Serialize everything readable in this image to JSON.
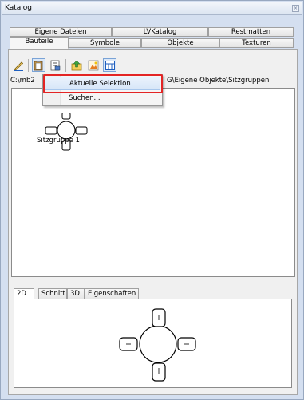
{
  "window": {
    "title": "Katalog",
    "close_glyph": "×"
  },
  "tabs_row1": [
    {
      "label": "Eigene Dateien"
    },
    {
      "label": "LVKatalog"
    },
    {
      "label": "Restmatten"
    }
  ],
  "tabs_row2": [
    {
      "label": "Bauteile",
      "active": true
    },
    {
      "label": "Symbole"
    },
    {
      "label": "Objekte"
    },
    {
      "label": "Texturen"
    }
  ],
  "toolbar": {
    "buttons": [
      {
        "icon": "pencil-icon"
      },
      {
        "icon": "clipboard-icon",
        "pressed": true
      },
      {
        "icon": "properties-icon"
      },
      {
        "icon": "folder-up-icon"
      },
      {
        "icon": "image-icon"
      },
      {
        "icon": "grid-view-icon",
        "pressed": true
      }
    ]
  },
  "path": {
    "left": "C:\\mb2",
    "right": "G\\Eigene Objekte\\Sitzgruppen"
  },
  "context_menu": {
    "items": [
      {
        "label": "Aktuelle Selektion",
        "highlighted": true
      },
      {
        "label": "Suchen..."
      }
    ]
  },
  "list": {
    "items": [
      {
        "label": "Sitzgruppe 1"
      }
    ]
  },
  "bottom_tabs": [
    {
      "label": "2D",
      "active": true
    },
    {
      "label": "Schnitt"
    },
    {
      "label": "3D"
    },
    {
      "label": "Eigenschaften"
    }
  ],
  "colors": {
    "highlight_outline": "#e32424",
    "window_bg": "#d4dff0"
  }
}
